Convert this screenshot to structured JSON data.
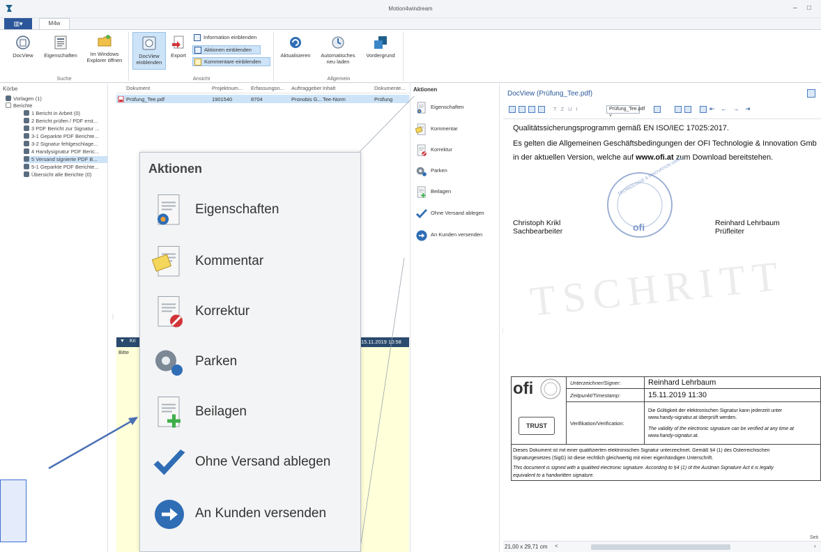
{
  "window": {
    "title": "Motion4windream",
    "minimize": "–",
    "maximize": "□"
  },
  "tabs": {
    "file_glyph": "▥▾",
    "m4w": "M4w"
  },
  "ribbon": {
    "groups": {
      "suche": {
        "label": "Suche",
        "buttons": [
          {
            "label": "DocView"
          },
          {
            "label": "Eigenschaften"
          },
          {
            "label_line1": "Im Windows",
            "label_line2": "Explorer öffnen"
          }
        ]
      },
      "ansicht": {
        "label": "Ansicht",
        "docview_line1": "DocView",
        "docview_line2": "einblenden",
        "export": "Export",
        "info": "Information einblenden",
        "aktionen": "Aktionen einblenden",
        "kommentare": "Kommentare einblenden"
      },
      "allgemein": {
        "label": "Allgemein",
        "aktualisieren": "Aktualisieren",
        "auto_line1": "Automatisches",
        "auto_line2": "neu laden",
        "vordergrund": "Vordergrund"
      }
    }
  },
  "korbe": {
    "header": "Körbe",
    "items": [
      {
        "label": "Vorlagen (1)",
        "indent": 0
      },
      {
        "label": "Berichte",
        "indent": 0
      },
      {
        "label": "1 Bericht in Arbeit (0)",
        "indent": 1
      },
      {
        "label": "2 Bericht prüfen / PDF erst...",
        "indent": 1
      },
      {
        "label": "3 PDF Bericht zur Signatur ...",
        "indent": 1
      },
      {
        "label": "3-1 Geparkte PDF Berichte...",
        "indent": 1
      },
      {
        "label": "3-2 Signatur fehlgeschlage...",
        "indent": 1
      },
      {
        "label": "4 Handysignatur PDF Beric...",
        "indent": 1
      },
      {
        "label": "5 Versand signierte PDF B...",
        "indent": 1,
        "selected": true
      },
      {
        "label": "5-1 Geparkte PDF Berichte...",
        "indent": 1
      },
      {
        "label": "Übersicht alle Berichte (0)",
        "indent": 1
      }
    ]
  },
  "doclist": {
    "columns": [
      "Dokument",
      "Projektnum...",
      "Erfassungsn...",
      "Auftraggeber",
      "Inhalt",
      "Dokumente..."
    ],
    "rows": [
      [
        "Prüfung_Tee.pdf",
        "1901540",
        "8704",
        "Pronobis G...",
        "Tee-Norm",
        "Prüfung"
      ]
    ]
  },
  "comments": {
    "header_label": "Kri",
    "timestamp": "15.11.2019 10:58",
    "first_line": "Bitte"
  },
  "aktionen": {
    "header": "Aktionen",
    "items": [
      {
        "label": "Eigenschaften",
        "icon": "properties-icon"
      },
      {
        "label": "Kommentar",
        "icon": "comment-icon"
      },
      {
        "label": "Korrektur",
        "icon": "correction-icon"
      },
      {
        "label": "Parken",
        "icon": "park-icon"
      },
      {
        "label": "Beilagen",
        "icon": "attachment-icon"
      },
      {
        "label": "Ohne Versand ablegen",
        "icon": "checkmark-icon"
      },
      {
        "label": "An Kunden versenden",
        "icon": "send-arrow-icon"
      }
    ]
  },
  "docview": {
    "title": "DocView (Prüfung_Tee.pdf)",
    "toolbar_combo": "Prüfung_Tee.pdf",
    "toolbar_letters": [
      "T",
      "Z",
      "U",
      "I"
    ],
    "status_size": "21,00 x 29,71 cm",
    "status_right": "Seit"
  },
  "pdf": {
    "line1": "Qualitätssicherungsprogramm gemäß EN ISO/IEC 17025:2017.",
    "line2": "Es gelten die Allgemeinen Geschäftsbedingungen der OFI Technologie & Innovation Gmb",
    "line3_pre": "in der aktuellen Version, welche auf ",
    "line3_link": "www.ofi.at",
    "line3_post": " zum Download bereitstehen.",
    "signer1_name": "Christoph Krikl",
    "signer1_role": "Sachbearbeiter",
    "signer2_name": "Reinhard Lehrbaum",
    "signer2_role": "Prüfleiter",
    "stamp_text": "TECHNOLOGIE & INNOVATION GMBH",
    "stamp_logo": "ofi",
    "watermark": "TSCHRITT",
    "sig": {
      "label_signer": "Unterzeichner/Signer:",
      "value_signer": "Reinhard Lehrbaum",
      "label_time": "Zeitpunkt/Timestamp:",
      "value_time": "15.11.2019 11:30",
      "label_verif": "Verifikation/Verification:",
      "verif_de": "Die Gültigkeit der elektronischen Signatur kann jederzeit unter",
      "verif_de2": "www.handy-signatur.at überprüft werden.",
      "verif_en": "The validity of the electronic signature can be verified at any time at",
      "verif_en2": "www.handy-signatur.at.",
      "logo_ofi": "ofi",
      "logo_trust": "TRUST",
      "footer_de": "Dieses Dokument ist mit einer qualifizierten elektronischen Signatur unterzeichnet. Gemäß §4 (1) des Österreichischen",
      "footer_de2": "Signaturgesetzes (SigG) ist diese rechtlich gleichwertig mit einer eigenhändigen Unterschrift.",
      "footer_en": "This document is signed with a qualified electronic signature. According to §4 (1) of the Austrian Signature Act it is legally",
      "footer_en2": "equivalent to a handwritten signature."
    }
  },
  "zoom_callout": {
    "title": "Aktionen",
    "items": [
      {
        "label": "Eigenschaften"
      },
      {
        "label": "Kommentar"
      },
      {
        "label": "Korrektur"
      },
      {
        "label": "Parken"
      },
      {
        "label": "Beilagen"
      },
      {
        "label": "Ohne Versand ablegen"
      },
      {
        "label": "An Kunden versenden"
      }
    ]
  },
  "colors": {
    "accent": "#2b579a",
    "selected_bg": "#cde3f7",
    "arrow": "#4a6fb5",
    "check_blue": "#2f6db5",
    "comment_bg": "#ffffd9"
  }
}
